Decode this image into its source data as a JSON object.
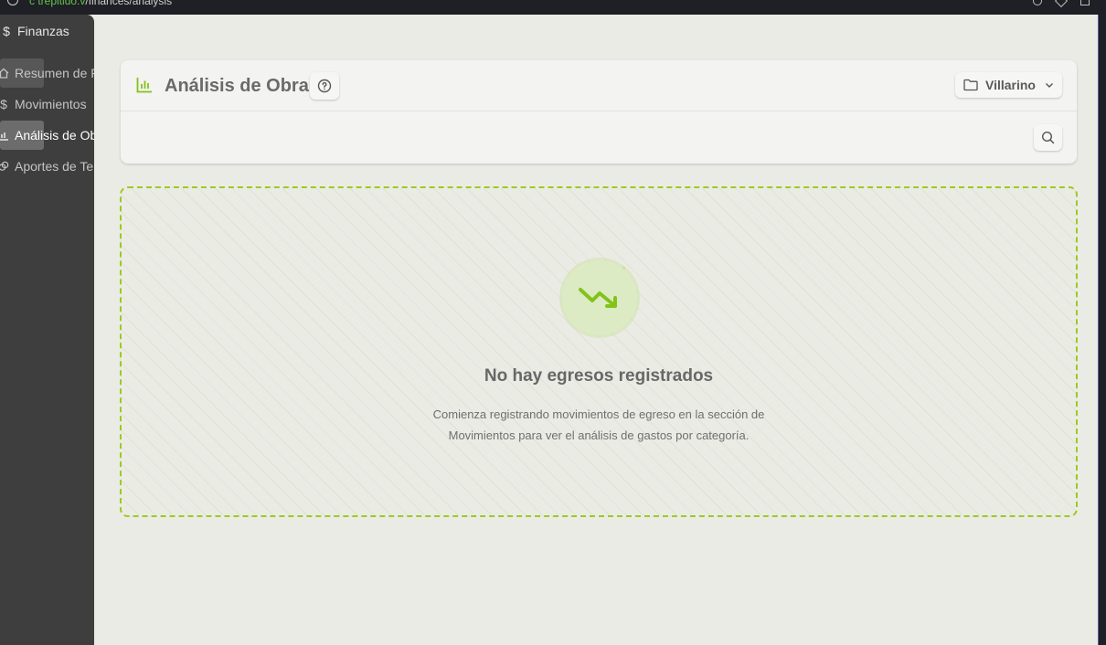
{
  "browser": {
    "url_prefix": "c",
    "url_host": "trepitido.v",
    "url_path": "/finances/analysis"
  },
  "sidebar": {
    "title": "Finanzas",
    "title_icon": "dollar-icon",
    "items": [
      {
        "label": "Resumen de F",
        "icon": "home-icon",
        "active": false
      },
      {
        "label": "Movimientos",
        "icon": "dollar-icon",
        "active": false
      },
      {
        "label": "Análisis de Ob",
        "icon": "bar-chart-icon",
        "active": true
      },
      {
        "label": "Aportes de Te",
        "icon": "coins-icon",
        "active": false
      }
    ]
  },
  "header": {
    "title": "Análisis de Obra",
    "title_icon": "bar-chart-icon",
    "help_icon": "help-circle-icon",
    "project_label": "Villarino",
    "project_icon": "folder-icon",
    "search_icon": "search-icon"
  },
  "empty_state": {
    "icon": "trending-down-icon",
    "title": "No hay egresos registrados",
    "description_line1": "Comienza registrando movimientos de egreso en la sección de",
    "description_line2": "Movimientos para ver el análisis de gastos por categoría."
  },
  "colors": {
    "accent": "#84c21a",
    "sidebar_bg": "#3e3e3e",
    "page_bg": "#ebebe6",
    "card_bg": "#f3f3f1"
  }
}
